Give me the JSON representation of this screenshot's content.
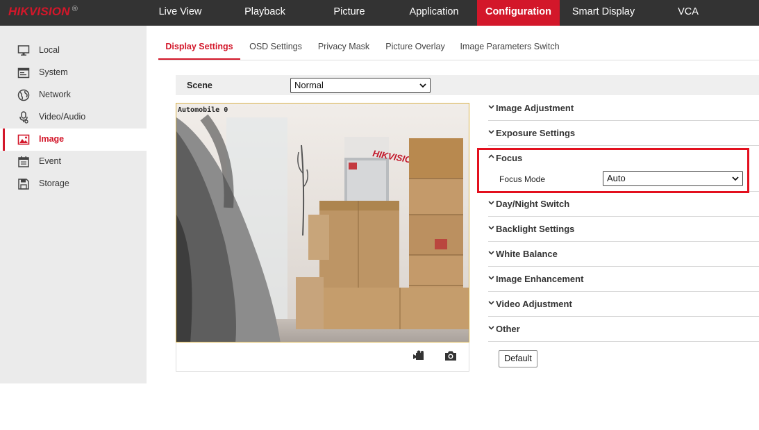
{
  "brand": {
    "logo_text": "HIKVISION",
    "logo_mark": "®",
    "accent_color": "#d3172a"
  },
  "top_nav": {
    "items": [
      {
        "label": "Live View",
        "active": false
      },
      {
        "label": "Playback",
        "active": false
      },
      {
        "label": "Picture",
        "active": false
      },
      {
        "label": "Application",
        "active": false
      },
      {
        "label": "Configuration",
        "active": true
      },
      {
        "label": "Smart Display",
        "active": false
      },
      {
        "label": "VCA",
        "active": false
      }
    ]
  },
  "sidebar": {
    "items": [
      {
        "label": "Local",
        "icon": "monitor-icon",
        "active": false
      },
      {
        "label": "System",
        "icon": "system-icon",
        "active": false
      },
      {
        "label": "Network",
        "icon": "globe-icon",
        "active": false
      },
      {
        "label": "Video/Audio",
        "icon": "microphone-icon",
        "active": false
      },
      {
        "label": "Image",
        "icon": "image-icon",
        "active": true
      },
      {
        "label": "Event",
        "icon": "calendar-icon",
        "active": false
      },
      {
        "label": "Storage",
        "icon": "floppy-icon",
        "active": false
      }
    ]
  },
  "tabs": {
    "items": [
      {
        "label": "Display Settings",
        "active": true
      },
      {
        "label": "OSD Settings",
        "active": false
      },
      {
        "label": "Privacy Mask",
        "active": false
      },
      {
        "label": "Picture Overlay",
        "active": false
      },
      {
        "label": "Image Parameters Switch",
        "active": false
      }
    ]
  },
  "scene": {
    "label": "Scene",
    "value": "Normal"
  },
  "preview": {
    "osd_text": "Automobile 0",
    "sign_text": "HIKVISION",
    "toolbar_icons": [
      "record-icon",
      "camera-icon"
    ]
  },
  "sections": {
    "items": [
      {
        "label": "Image Adjustment",
        "expanded": false
      },
      {
        "label": "Exposure Settings",
        "expanded": false
      },
      {
        "label": "Focus",
        "expanded": true
      },
      {
        "label": "Day/Night Switch",
        "expanded": false
      },
      {
        "label": "Backlight Settings",
        "expanded": false
      },
      {
        "label": "White Balance",
        "expanded": false
      },
      {
        "label": "Image Enhancement",
        "expanded": false
      },
      {
        "label": "Video Adjustment",
        "expanded": false
      },
      {
        "label": "Other",
        "expanded": false
      }
    ]
  },
  "focus": {
    "mode_label": "Focus Mode",
    "mode_value": "Auto",
    "highlight_color": "#e3101e"
  },
  "actions": {
    "default_label": "Default"
  }
}
